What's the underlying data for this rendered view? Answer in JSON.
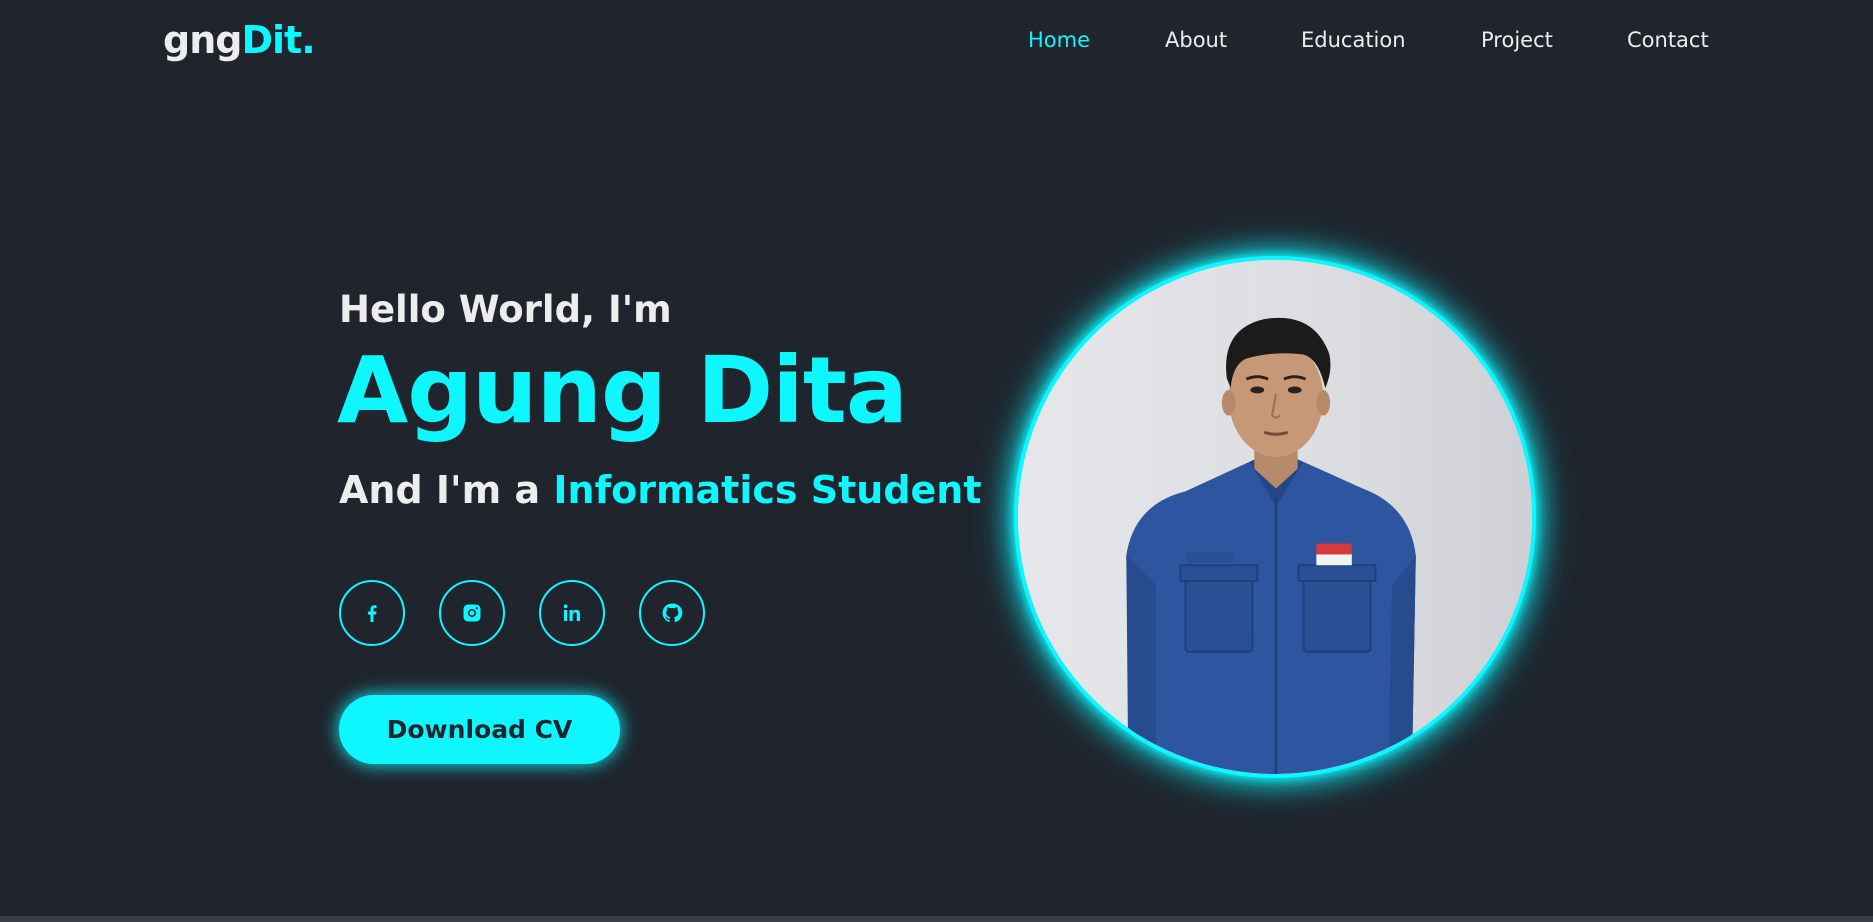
{
  "header": {
    "logo_main": "gng",
    "logo_accent": "Dit."
  },
  "nav": {
    "items": [
      {
        "label": "Home",
        "active": true
      },
      {
        "label": "About",
        "active": false
      },
      {
        "label": "Education",
        "active": false
      },
      {
        "label": "Project",
        "active": false
      },
      {
        "label": "Contact",
        "active": false
      }
    ]
  },
  "hero": {
    "greeting": "Hello World, I'm",
    "name": "Agung Dita",
    "role_prefix": "And I'm a ",
    "role_accent": "Informatics Student",
    "cv_button": "Download CV"
  },
  "socials": [
    {
      "icon": "facebook-icon"
    },
    {
      "icon": "instagram-icon"
    },
    {
      "icon": "linkedin-icon"
    },
    {
      "icon": "github-icon"
    }
  ],
  "colors": {
    "background": "#1f242d",
    "accent": "#0ef6ff",
    "text": "#ededed"
  }
}
